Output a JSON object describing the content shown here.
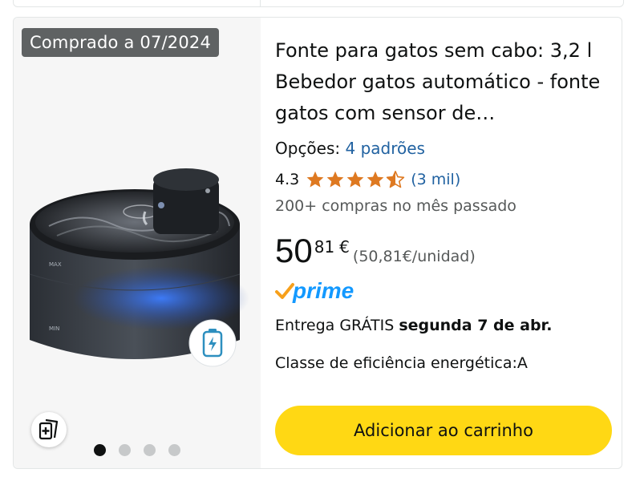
{
  "product": {
    "purchase_badge": "Comprado a 07/2024",
    "title": "Fonte para gatos sem cabo: 3,2 l Bebedor gatos automático - fonte gatos com sensor de…",
    "options_label": "Opções:",
    "options_value": "4 padrões",
    "rating_value": "4.3",
    "rating_stars": 4.3,
    "rating_count": "(3 mil)",
    "bought_text": "200+ compras no mês passado",
    "price_integer": "50",
    "price_decimal": "81",
    "price_currency": "€",
    "unit_price": "(50,81€/unidad)",
    "prime_label": "prime",
    "delivery_prefix": "Entrega GRÁTIS",
    "delivery_date": "segunda 7 de abr.",
    "energy_class": "Classe de eficiência energética:A",
    "add_to_cart_label": "Adicionar ao carrinho"
  },
  "carousel": {
    "total": 4,
    "active": 1
  },
  "icons": {
    "compare": "compare-cards-icon",
    "battery": "battery-icon",
    "star": "star-icon",
    "prime_check": "prime-check-icon"
  },
  "colors": {
    "star": "#de7921",
    "link": "#2162a1",
    "prime": "#1399ff",
    "cart_button": "#ffd814",
    "badge_bg": "#5f6263"
  }
}
